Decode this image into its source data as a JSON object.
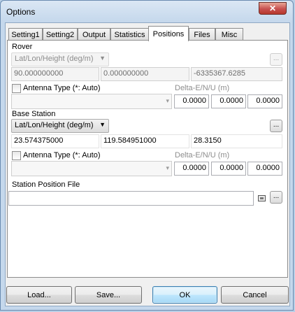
{
  "window": {
    "title": "Options",
    "close_glyph": "✕"
  },
  "tabs": [
    {
      "label": "Setting1"
    },
    {
      "label": "Setting2"
    },
    {
      "label": "Output"
    },
    {
      "label": "Statistics"
    },
    {
      "label": "Positions",
      "active": true
    },
    {
      "label": "Files"
    },
    {
      "label": "Misc"
    }
  ],
  "rover": {
    "section_label": "Rover",
    "position_format": "Lat/Lon/Height (deg/m)",
    "lat": "90.000000000",
    "lon": "0.000000000",
    "height": "-6335367.6285",
    "antenna_label": "Antenna Type (*: Auto)",
    "delta_label": "Delta-E/N/U (m)",
    "delta_e": "0.0000",
    "delta_n": "0.0000",
    "delta_u": "0.0000",
    "browse_label": "..."
  },
  "base": {
    "section_label": "Base Station",
    "position_format": "Lat/Lon/Height (deg/m)",
    "lat": "23.574375000",
    "lon": "119.584951000",
    "height": "28.3150",
    "antenna_label": "Antenna Type (*: Auto)",
    "delta_label": "Delta-E/N/U (m)",
    "delta_e": "0.0000",
    "delta_n": "0.0000",
    "delta_u": "0.0000",
    "browse_label": "..."
  },
  "station_file": {
    "label": "Station Position File",
    "value": "",
    "browse_label": "..."
  },
  "buttons": {
    "load": "Load...",
    "save": "Save...",
    "ok": "OK",
    "cancel": "Cancel"
  },
  "icons": {
    "combo_arrow": "▼",
    "dropdown_arrow": "▾"
  }
}
